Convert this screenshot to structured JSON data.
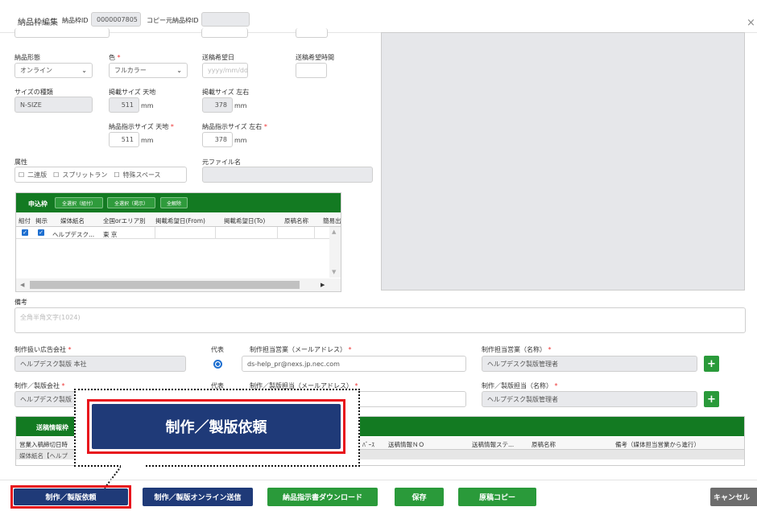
{
  "header": {
    "title": "納品枠編集",
    "slot_id_label": "納品枠ID",
    "slot_id_value": "0000007805",
    "copy_source_label": "コピー元納品枠ID",
    "copy_source_value": "",
    "close_glyph": "×"
  },
  "form": {
    "delivery_format": {
      "label": "納品形態",
      "value": "オンライン"
    },
    "color": {
      "label": "色",
      "value": "フルカラー"
    },
    "send_date": {
      "label": "送稿希望日",
      "placeholder": "yyyy/mm/dd"
    },
    "send_time": {
      "label": "送稿希望時間",
      "value": ""
    },
    "size_type": {
      "label": "サイズの種類",
      "value": "N-SIZE"
    },
    "pub_size_height": {
      "label": "掲載サイズ 天地",
      "value": "511",
      "unit": "mm"
    },
    "pub_size_width": {
      "label": "掲載サイズ 左右",
      "value": "378",
      "unit": "mm"
    },
    "instr_size_height": {
      "label": "納品指示サイズ 天地",
      "value": "511",
      "unit": "mm"
    },
    "instr_size_width": {
      "label": "納品指示サイズ 左右",
      "value": "378",
      "unit": "mm"
    },
    "attributes": {
      "label": "属性",
      "options": [
        "二連版",
        "スプリットラン",
        "特殊スペース"
      ]
    },
    "source_file": {
      "label": "元ファイル名",
      "value": ""
    },
    "remarks": {
      "label": "備考",
      "placeholder": "全角半角文字(1024)"
    },
    "ad_company": {
      "label": "制作扱い広告会社",
      "value": "ヘルプデスク製版 本社"
    },
    "rep1_label": "代表",
    "sales_email": {
      "label": "制作担当営業（メールアドレス）",
      "value": "ds-help_pr@nexs.jp.nec.com"
    },
    "sales_name": {
      "label": "制作担当営業（名称）",
      "value": "ヘルプデスク製版管理者"
    },
    "prod_company": {
      "label": "制作／製版会社",
      "value": "ヘルプデスク製版"
    },
    "rep2_label": "代表",
    "prod_email": {
      "label": "制作／製版担当（メールアドレス）",
      "value": ""
    },
    "prod_name": {
      "label": "制作／製版担当（名称）",
      "value": "ヘルプデスク製版管理者"
    },
    "plus_glyph": "+"
  },
  "application_table": {
    "title": "申込枠",
    "buttons": [
      "全選択（組付）",
      "全選択（掲示）",
      "全解除"
    ],
    "columns": [
      "組付",
      "掲示",
      "媒体紙名",
      "全国orエリア別",
      "掲載希望日(From)",
      "掲載希望日(To)",
      "原稿名称",
      "簡易出"
    ],
    "rows": [
      {
        "media": "ヘルプデスク...",
        "area": "東 京",
        "from": "",
        "to": "",
        "name": "",
        "note": ""
      }
    ]
  },
  "send_info_table": {
    "title": "送稿情報枠",
    "columns": [
      "営業入稿締切日時",
      "ﾊﾞｰｽ",
      "送稿情報ＮＯ",
      "送稿情報ステ...",
      "原稿名称",
      "備考（媒体担当営業から進行）"
    ],
    "group_row": "媒体紙名【ヘルプ"
  },
  "footer": {
    "buttons": [
      "制作／製版依頼",
      "制作／製版オンライン送信",
      "納品指示書ダウンロード",
      "保存",
      "原稿コピー",
      "キャンセル"
    ]
  },
  "callout": {
    "text": "制作／製版依頼"
  },
  "colors": {
    "green": "#2a9a3a",
    "navy": "#1f3a78",
    "highlight": "#e8141c"
  }
}
